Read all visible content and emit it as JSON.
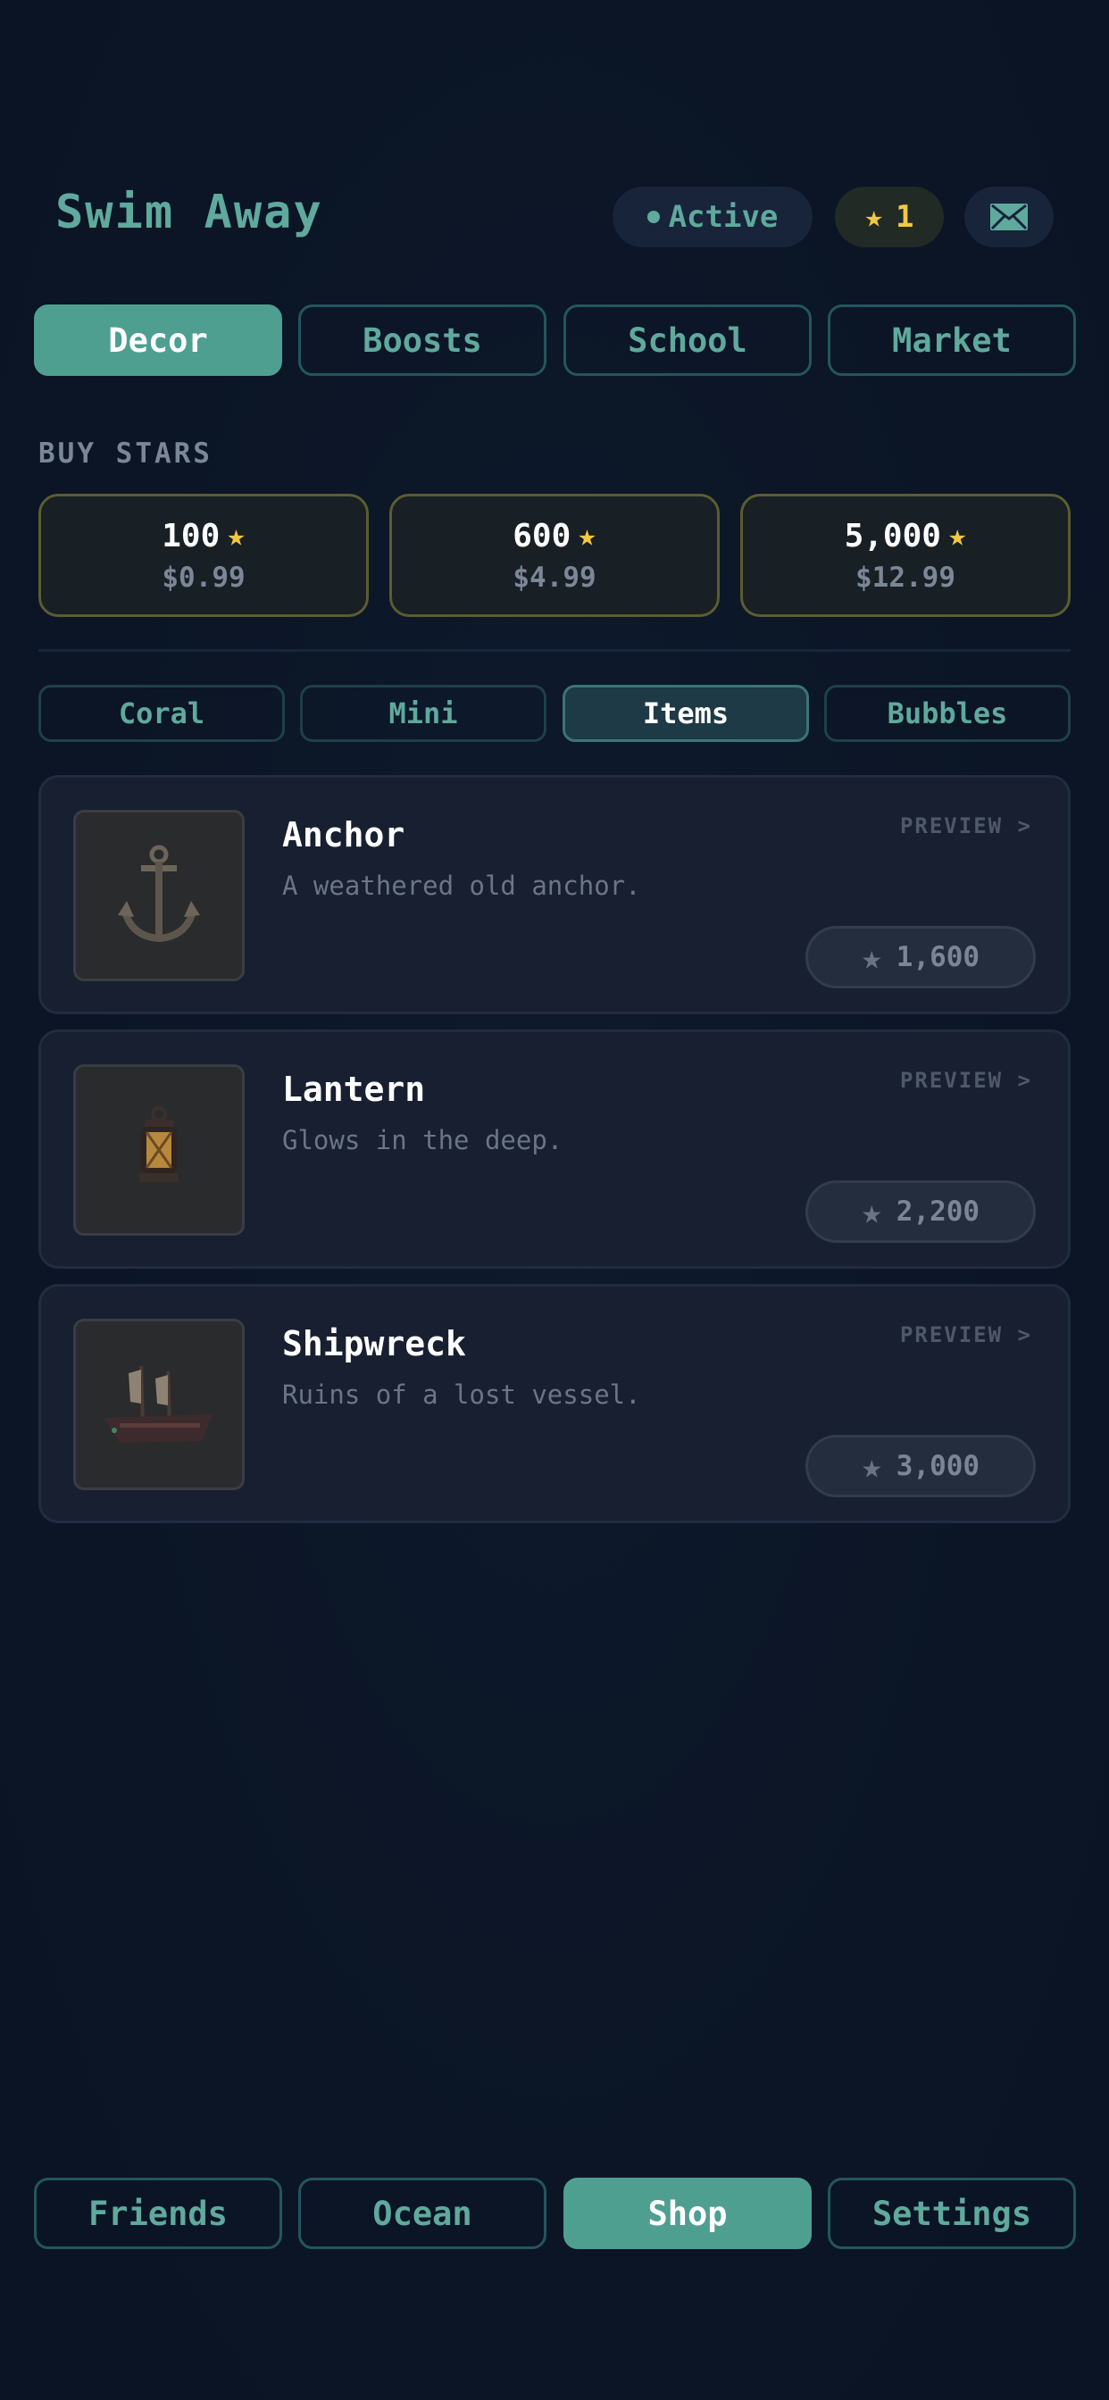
{
  "header": {
    "title": "Swim Away",
    "status": "Active",
    "star_balance": "1",
    "mail_icon": "mail-icon"
  },
  "top_tabs": [
    {
      "label": "Decor",
      "active": true
    },
    {
      "label": "Boosts",
      "active": false
    },
    {
      "label": "School",
      "active": false
    },
    {
      "label": "Market",
      "active": false
    }
  ],
  "buy_stars": {
    "label": "BUY STARS",
    "packs": [
      {
        "amount": "100",
        "price": "$0.99"
      },
      {
        "amount": "600",
        "price": "$4.99"
      },
      {
        "amount": "5,000",
        "price": "$12.99"
      }
    ]
  },
  "sub_tabs": [
    {
      "label": "Coral",
      "active": false
    },
    {
      "label": "Mini",
      "active": false
    },
    {
      "label": "Items",
      "active": true
    },
    {
      "label": "Bubbles",
      "active": false
    }
  ],
  "items": [
    {
      "name": "Anchor",
      "desc": "A weathered old anchor.",
      "preview": "PREVIEW >",
      "price": "1,600",
      "icon": "anchor-icon"
    },
    {
      "name": "Lantern",
      "desc": "Glows in the deep.",
      "preview": "PREVIEW >",
      "price": "2,200",
      "icon": "lantern-icon"
    },
    {
      "name": "Shipwreck",
      "desc": "Ruins of a lost vessel.",
      "preview": "PREVIEW >",
      "price": "3,000",
      "icon": "shipwreck-icon"
    }
  ],
  "bottom_nav": [
    {
      "label": "Friends",
      "active": false
    },
    {
      "label": "Ocean",
      "active": false
    },
    {
      "label": "Shop",
      "active": true
    },
    {
      "label": "Settings",
      "active": false
    }
  ],
  "colors": {
    "accent": "#4f9f91",
    "star": "#f2c744",
    "background": "#0c1627"
  }
}
